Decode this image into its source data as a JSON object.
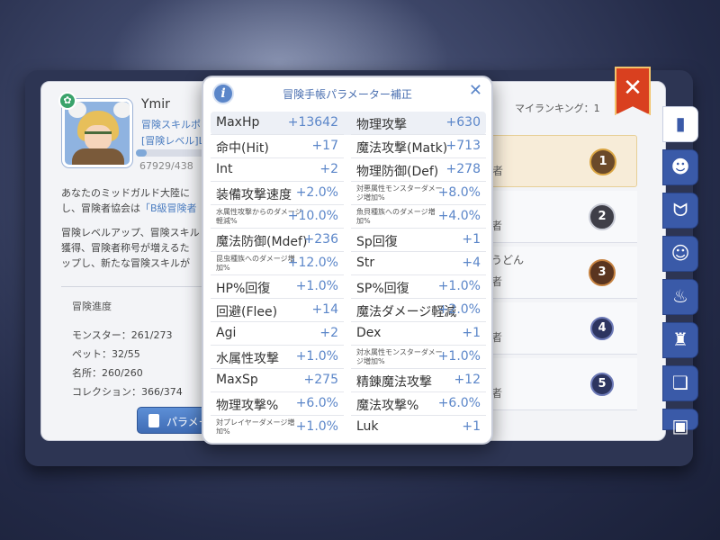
{
  "profile": {
    "name": "Ymir",
    "skill_line": "冒険スキルポイ",
    "level_line": "[冒険レベル]L",
    "exp_text": "67929/438",
    "exp_fraction": 0.155
  },
  "description": {
    "para1_line1": "あなたのミッドガルド大陸に",
    "para1_line2_prefix": "し、冒険者協会は",
    "para1_line2_highlight": "「B級冒険者",
    "para2_line1": "冒険レベルアップ、冒険スキル",
    "para2_line2": "獲得、冒険者称号が増えるた",
    "para2_line3": "ップし、新たな冒険スキルが"
  },
  "progress": {
    "title": "冒険進度",
    "items": [
      "モンスター：261/273",
      "ペット：32/55",
      "名所：260/260",
      "コレクション：366/374"
    ]
  },
  "param_button_label": "パラメー",
  "ranking": {
    "my_rank_label": "マイランキング：1",
    "rows": [
      {
        "text": "",
        "sub": "者",
        "rank": "1",
        "style": "gold"
      },
      {
        "text": "",
        "sub": "者",
        "rank": "2",
        "style": "silver"
      },
      {
        "text": "うどん",
        "sub": "者",
        "rank": "3",
        "style": "bronze"
      },
      {
        "text": "",
        "sub": "者",
        "rank": "4",
        "style": "plain"
      },
      {
        "text": "",
        "sub": "者",
        "rank": "5",
        "style": "plain"
      }
    ]
  },
  "side_tabs": [
    "book-icon",
    "devil-face-icon",
    "horns-icon",
    "chat-face-icon",
    "chef-hat-icon",
    "guild-icon",
    "open-book-icon",
    "card-icon"
  ],
  "modal": {
    "title": "冒険手帳パラメーター補正",
    "rows": [
      {
        "l_label": "MaxHp",
        "l_value": "+13642",
        "r_label": "物理攻撃",
        "r_value": "+630",
        "l_small": false,
        "r_small": false
      },
      {
        "l_label": "命中(Hit)",
        "l_value": "+17",
        "r_label": "魔法攻撃(Matk)",
        "r_value": "+713",
        "l_small": false,
        "r_small": false
      },
      {
        "l_label": "Int",
        "l_value": "+2",
        "r_label": "物理防御(Def)",
        "r_value": "+278",
        "l_small": false,
        "r_small": false
      },
      {
        "l_label": "装備攻撃速度",
        "l_value": "+2.0%",
        "r_label": "対悪属性モンスターダメージ増加%",
        "r_value": "+8.0%",
        "l_small": false,
        "r_small": true
      },
      {
        "l_label": "水属性攻撃からのダメージ軽減%",
        "l_value": "+10.0%",
        "r_label": "魚貝種族へのダメージ増加%",
        "r_value": "+4.0%",
        "l_small": true,
        "r_small": true
      },
      {
        "l_label": "魔法防御(Mdef)",
        "l_value": "+236",
        "r_label": "Sp回復",
        "r_value": "+1",
        "l_small": false,
        "r_small": false
      },
      {
        "l_label": "昆虫種族へのダメージ増加%",
        "l_value": "+12.0%",
        "r_label": "Str",
        "r_value": "+4",
        "l_small": true,
        "r_small": false
      },
      {
        "l_label": "HP%回復",
        "l_value": "+1.0%",
        "r_label": "SP%回復",
        "r_value": "+1.0%",
        "l_small": false,
        "r_small": false
      },
      {
        "l_label": "回避(Flee)",
        "l_value": "+14",
        "r_label": "魔法ダメージ軽減",
        "r_value": "+2.0%",
        "l_small": false,
        "r_small": false
      },
      {
        "l_label": "Agi",
        "l_value": "+2",
        "r_label": "Dex",
        "r_value": "+1",
        "l_small": false,
        "r_small": false
      },
      {
        "l_label": "水属性攻撃",
        "l_value": "+1.0%",
        "r_label": "対水属性モンスターダメージ増加%",
        "r_value": "+1.0%",
        "l_small": false,
        "r_small": true
      },
      {
        "l_label": "MaxSp",
        "l_value": "+275",
        "r_label": "精錬魔法攻撃",
        "r_value": "+12",
        "l_small": false,
        "r_small": false
      },
      {
        "l_label": "物理攻撃%",
        "l_value": "+6.0%",
        "r_label": "魔法攻撃%",
        "r_value": "+6.0%",
        "l_small": false,
        "r_small": false
      },
      {
        "l_label": "対プレイヤーダメージ増加%",
        "l_value": "+1.0%",
        "r_label": "Luk",
        "r_value": "+1",
        "l_small": true,
        "r_small": false
      }
    ]
  }
}
